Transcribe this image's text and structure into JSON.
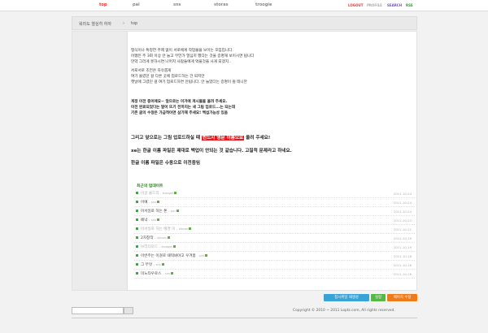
{
  "nav": {
    "tabs": [
      "top",
      "pai",
      "sns",
      "storas",
      "troogie"
    ],
    "active": "top"
  },
  "util": [
    {
      "label": "LOGOUT",
      "color": "#e53333"
    },
    {
      "label": "PROFILE",
      "color": "#aaaaaa"
    },
    {
      "label": "SEARCH",
      "color": "#7a4fc6"
    },
    {
      "label": "RSS",
      "color": "#2d9a2d"
    }
  ],
  "breadcrumb": {
    "home": "워라도 열심히 하자",
    "sep": "›",
    "current": "top"
  },
  "intro": [
    "형식이나 특정한 주제 없이 서로에게 작업물을 보이는 모임입니다.",
    "어쨌든 주 3회 이상 안 늘고 무언가 열심히 했다는 것을 증명해 보이시면 됩니다",
    "만약 그러게 못하시면 나머지 사람들에게 먹을것을 사게 되겠지.."
  ],
  "notes": [
    "서로서로 조언은 자유롭게",
    "여기 올렸던 걸 다른 곳에 업로드하는 건 되지만",
    "옛날에 그렸던 걸 여기 업로드하면 안됩니다. 안 늘었다는 증명이 될 테니깐"
  ],
  "rules": [
    "게정 이전 중이에요~ 앞으로는 이거에 게시물을 올려 주세요.",
    "이전 완료되었다는 말이 뜨기 전까지는 새 그림 업로드...는 되는데",
    "기존 글의 수정은 가급적이면 삼가해 주세요! 백섭가능성 있음"
  ],
  "announce": {
    "line1_pre": "그리고 앞으로는 그림 업로드하실 때 ",
    "line1_hl": "반드시 영문 이름으로",
    "line1_post": " 올려 주세요!",
    "line2": "xe는 한글 이름 파일은 제대로 백업이 안되는 것 같습니다. 고질적 문제라고 하네요.",
    "line3": "한글 이름 파일은 수동으로 이전중임"
  },
  "updates": {
    "title": "최근의 업데이트",
    "items": [
      {
        "title": "이글 올드리",
        "author": "troogie",
        "date": "2011-10-24",
        "dim": true
      },
      {
        "title": "어예",
        "author": "sns",
        "date": "2011-10-24",
        "dim": false
      },
      {
        "title": "어서일로 하는 톤",
        "author": "pai",
        "date": "2011-10-24",
        "dim": false
      },
      {
        "title": "페넉",
        "author": "sns",
        "date": "2011-10-23",
        "dim": false
      },
      {
        "title": "어서일로 하는 배경 이",
        "author": "storas",
        "date": "2011-10-21",
        "dim": true
      },
      {
        "title": "2차창작",
        "author": "storas",
        "date": "2011-10-19",
        "dim": false
      },
      {
        "title": "브리더모드",
        "author": "troogie",
        "date": "2011-10-19",
        "dim": true
      },
      {
        "title": "이번주는 이걸로 때워봐야고 우겨봄",
        "author": "pai",
        "date": "2011-10-18",
        "dim": false
      },
      {
        "title": "그 무엇",
        "author": "sns",
        "date": "2011-10-18",
        "dim": false
      },
      {
        "title": "미노타우로스",
        "author": "sns",
        "date": "2011-10-18",
        "dim": false
      }
    ]
  },
  "buttons": [
    {
      "label": "첨시위일 재생성",
      "color": "#38a3d9"
    },
    {
      "label": "설정",
      "color": "#55b745"
    },
    {
      "label": "페이지 수정",
      "color": "#ef7a1a"
    }
  ],
  "footer": {
    "copyright": "Copyright © 2010 ~ 2011 Loptz.com, All rights reserved."
  }
}
